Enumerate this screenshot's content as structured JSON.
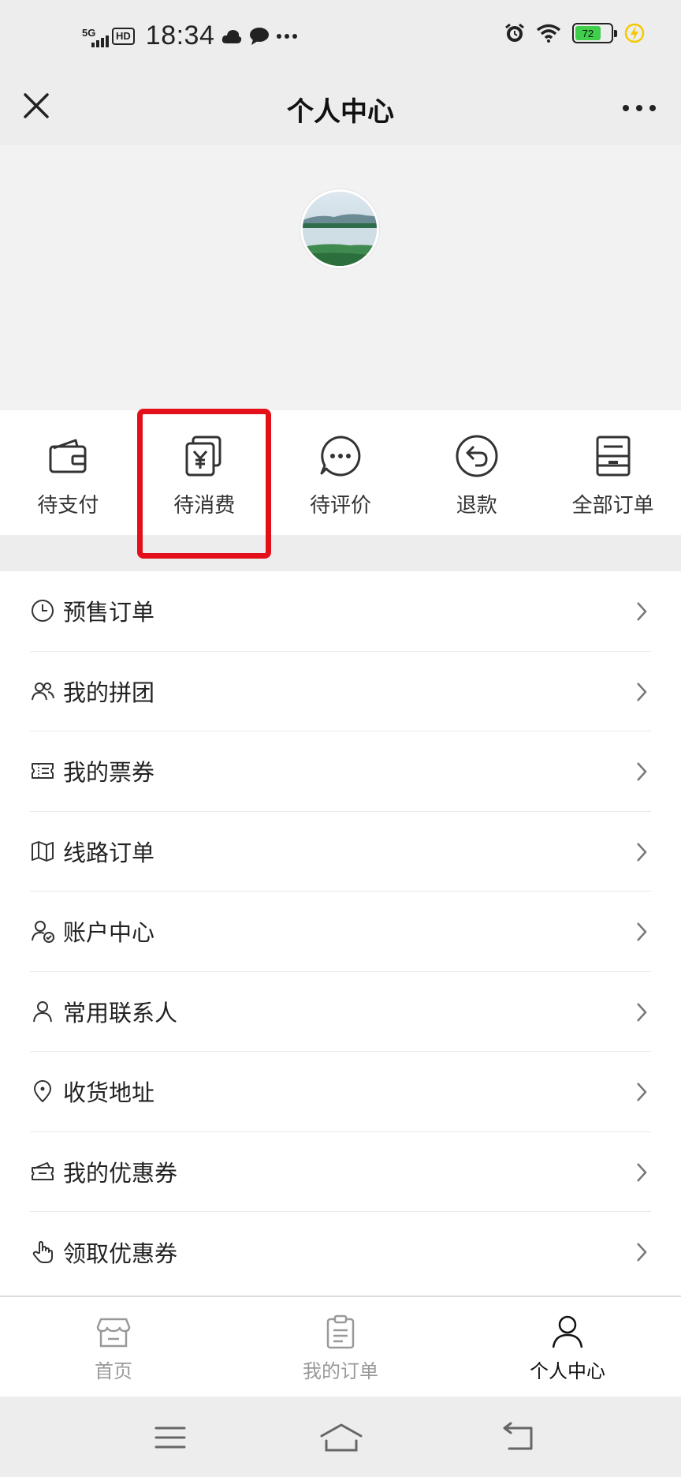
{
  "status_bar": {
    "network": "5G",
    "hd": "HD",
    "time": "18:34",
    "battery": "72",
    "icons": [
      "cloud-icon",
      "chat-bubble-icon",
      "more-dots-icon",
      "alarm-icon",
      "wifi-icon",
      "battery-icon",
      "charging-bolt-icon"
    ]
  },
  "nav": {
    "title": "个人中心",
    "close_icon": "close-icon",
    "more_icon": "more-icon"
  },
  "profile": {
    "avatar": "avatar"
  },
  "orders": [
    {
      "label": "待支付",
      "icon": "wallet-icon"
    },
    {
      "label": "待消费",
      "icon": "yen-coupon-icon"
    },
    {
      "label": "待评价",
      "icon": "chat-dots-icon"
    },
    {
      "label": "退款",
      "icon": "refund-arrow-icon"
    },
    {
      "label": "全部订单",
      "icon": "all-orders-icon"
    }
  ],
  "menu": [
    {
      "label": "预售订单",
      "icon": "clock-icon"
    },
    {
      "label": "我的拼团",
      "icon": "group-icon"
    },
    {
      "label": "我的票券",
      "icon": "ticket-icon"
    },
    {
      "label": "线路订单",
      "icon": "map-icon"
    },
    {
      "label": "账户中心",
      "icon": "account-verified-icon"
    },
    {
      "label": "常用联系人",
      "icon": "person-icon"
    },
    {
      "label": "收货地址",
      "icon": "location-pin-icon"
    },
    {
      "label": "我的优惠券",
      "icon": "coupon-icon"
    },
    {
      "label": "领取优惠券",
      "icon": "hand-pointer-icon"
    }
  ],
  "tabs": [
    {
      "label": "首页",
      "icon": "store-icon",
      "active": false
    },
    {
      "label": "我的订单",
      "icon": "clipboard-icon",
      "active": false
    },
    {
      "label": "个人中心",
      "icon": "user-icon",
      "active": true
    }
  ],
  "system_nav": [
    "menu-lines-icon",
    "home-icon",
    "back-icon"
  ],
  "colors": {
    "highlight": "#e3101a",
    "battery": "#3fcf4b",
    "inactive_tab": "#999999",
    "active_tab": "#111111"
  }
}
